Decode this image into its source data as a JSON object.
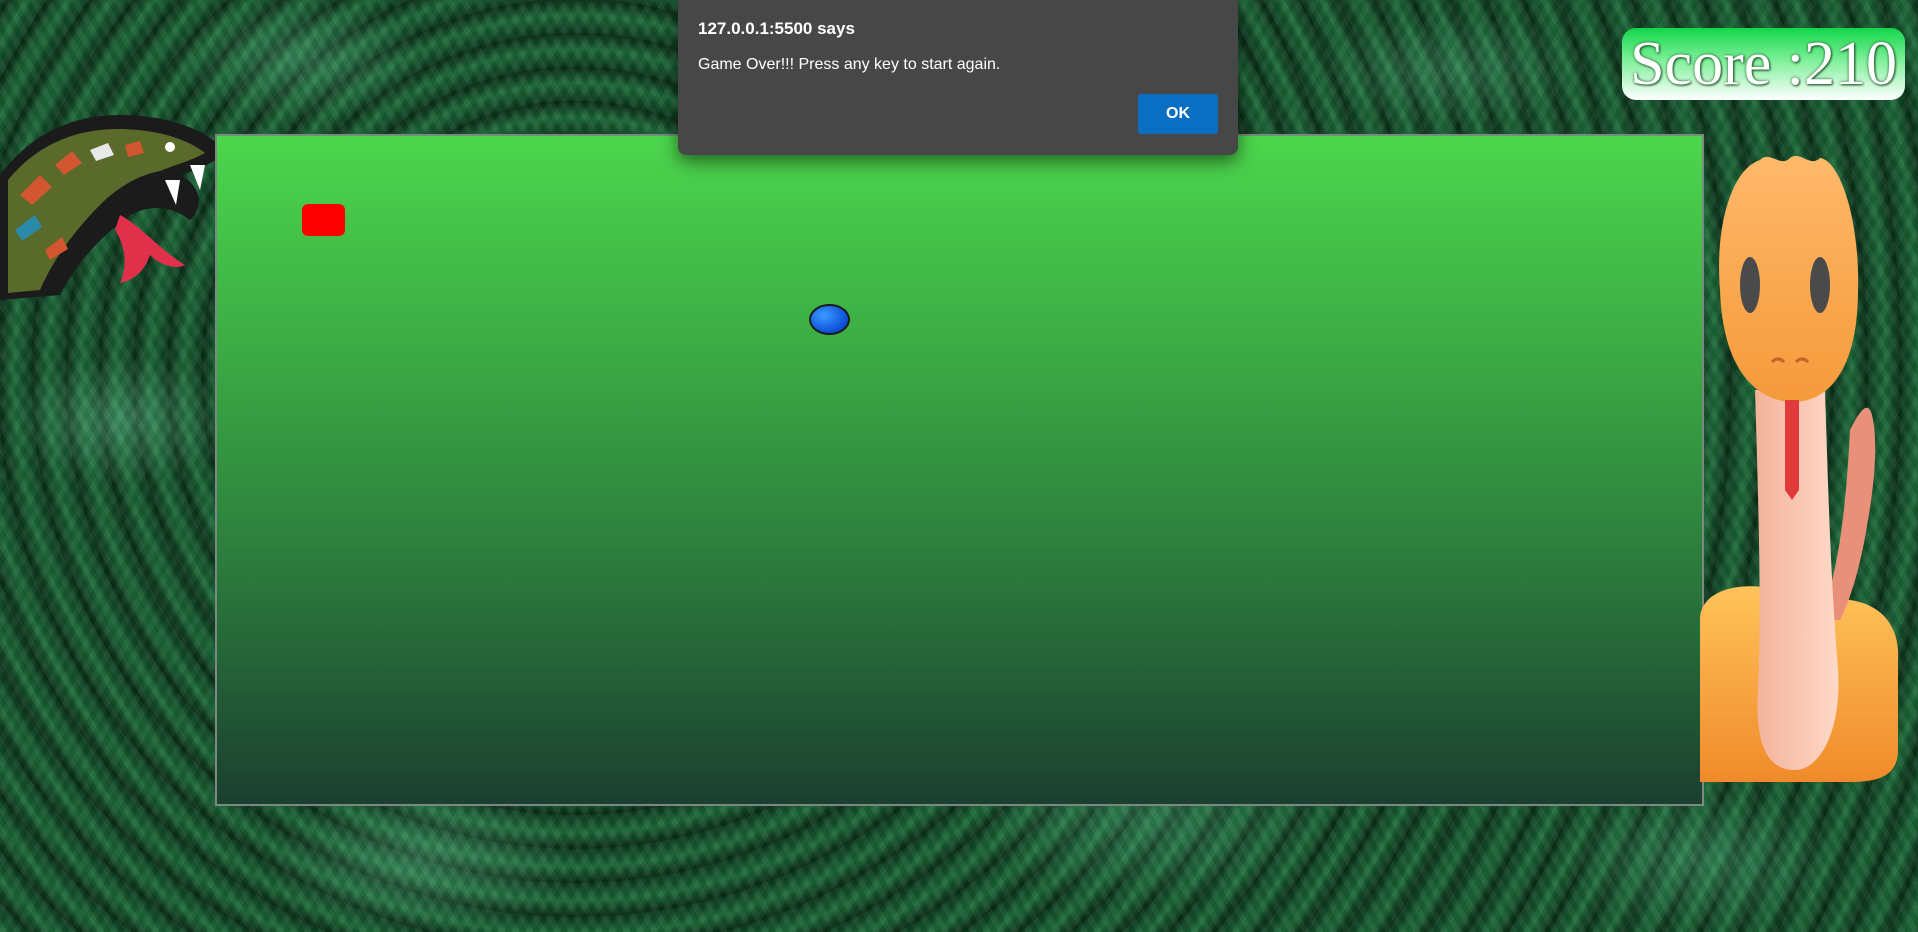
{
  "dialog": {
    "title": "127.0.0.1:5500 says",
    "message": "Game Over!!! Press any key to start again.",
    "ok_label": "OK"
  },
  "score": {
    "text": "Score :210"
  },
  "game": {
    "food_color": "#ff0000",
    "snake_head_color": "#0a4fd6",
    "board_gradient": [
      "#4cd64c",
      "#1b3f30"
    ]
  },
  "decorations": {
    "left": "tribal-snake-illustration",
    "right": "cartoon-orange-snake-illustration",
    "background": "green-snake-scales"
  }
}
